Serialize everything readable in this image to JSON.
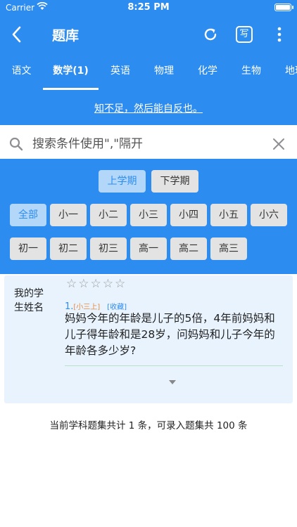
{
  "status": {
    "carrier": "Carrier",
    "time": "8:25 PM"
  },
  "nav": {
    "title": "题库",
    "write_label": "写"
  },
  "tabs": [
    {
      "label": "语文"
    },
    {
      "label": "数学(1)"
    },
    {
      "label": "英语"
    },
    {
      "label": "物理"
    },
    {
      "label": "化学"
    },
    {
      "label": "生物"
    },
    {
      "label": "地理"
    }
  ],
  "quote": "知不足，然后能自反也。",
  "search": {
    "placeholder": "搜索条件使用\",\"隔开",
    "value": ""
  },
  "terms": [
    "上学期",
    "下学期"
  ],
  "grades_row1": [
    "全部",
    "小一",
    "小二",
    "小三",
    "小四",
    "小五",
    "小六"
  ],
  "grades_row2": [
    "初一",
    "初二",
    "初三",
    "高一",
    "高二",
    "高三"
  ],
  "card": {
    "student_name": "我的学生姓名",
    "stars": "☆☆☆☆☆",
    "number": "1.",
    "grade_tag": "[小三上]",
    "favorite": "[收藏]",
    "question": "妈妈今年的年龄是儿子的5倍，4年前妈妈和儿子得年龄和是28岁，问妈妈和儿子今年的年龄各多少岁?"
  },
  "footer": "当前学科题集共计 1 条，可录入题集共 100 条"
}
